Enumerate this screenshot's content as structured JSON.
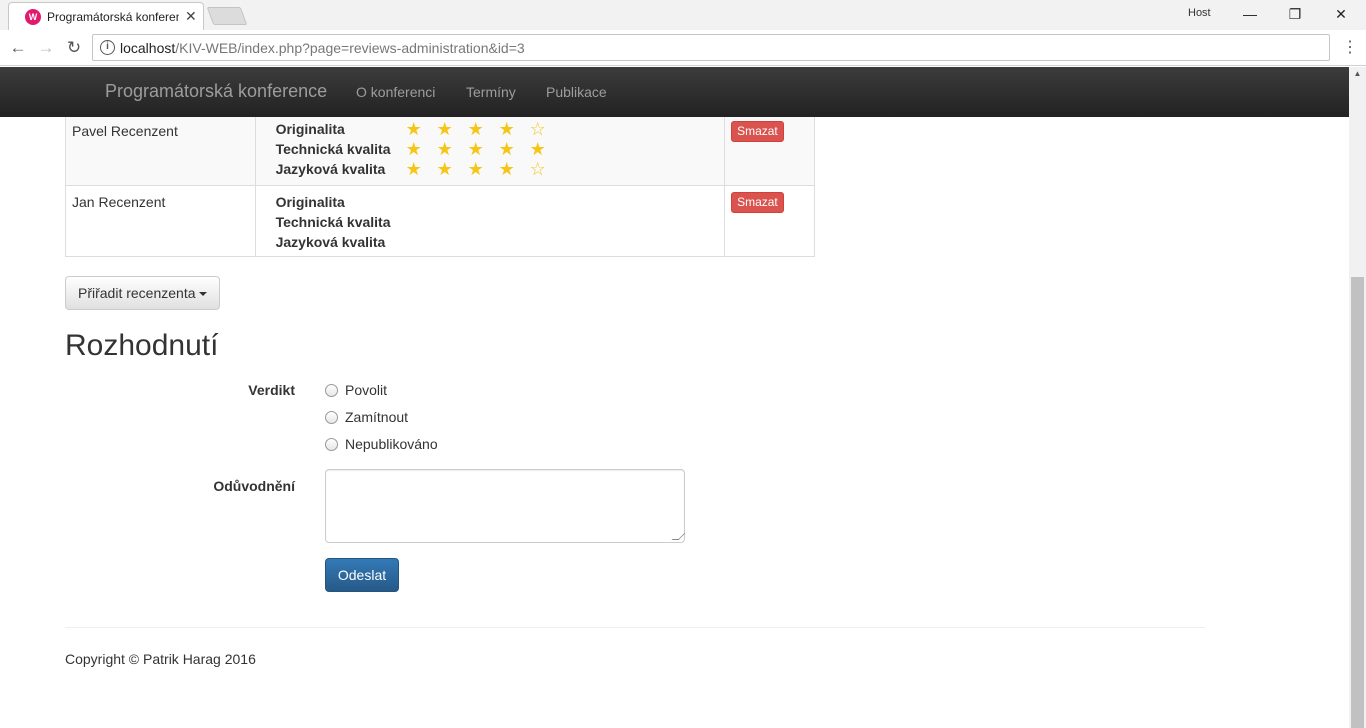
{
  "browser": {
    "tab_title": "Programátorská konferen",
    "tab_close": "✕",
    "profile_name": "Host",
    "url_host": "localhost",
    "url_path": "/KIV-WEB/index.php?page=reviews-administration&id=3",
    "window_buttons": [
      "—",
      "❐",
      "✕"
    ],
    "nav_icons": [
      "arrow-left-icon",
      "arrow-right-icon",
      "reload-icon",
      "info-icon",
      "menu-icon"
    ]
  },
  "navbar": {
    "brand": "Programátorská konference",
    "links": [
      "O konferenci",
      "Termíny",
      "Publikace"
    ]
  },
  "reviews": [
    {
      "reviewer": "Pavel Recenzent",
      "criteria": [
        {
          "name": "Originalita",
          "rating": 4,
          "max": 5
        },
        {
          "name": "Technická kvalita",
          "rating": 5,
          "max": 5
        },
        {
          "name": "Jazyková kvalita",
          "rating": 4,
          "max": 5
        }
      ],
      "delete_label": "Smazat"
    },
    {
      "reviewer": "Jan Recenzent",
      "criteria": [
        {
          "name": "Originalita"
        },
        {
          "name": "Technická kvalita"
        },
        {
          "name": "Jazyková kvalita"
        }
      ],
      "delete_label": "Smazat"
    }
  ],
  "assign_button": "Přiřadit recenzenta",
  "decision": {
    "title": "Rozhodnutí",
    "verdict_label": "Verdikt",
    "options": [
      "Povolit",
      "Zamítnout",
      "Nepublikováno"
    ],
    "reason_label": "Odůvodnění",
    "reason_value": "",
    "submit_label": "Odeslat"
  },
  "footer": "Copyright © Patrik Harag 2016",
  "colors": {
    "star": "#f5c518",
    "danger": "#d9534f",
    "primary": "#337ab7",
    "navbar": "#222222"
  }
}
